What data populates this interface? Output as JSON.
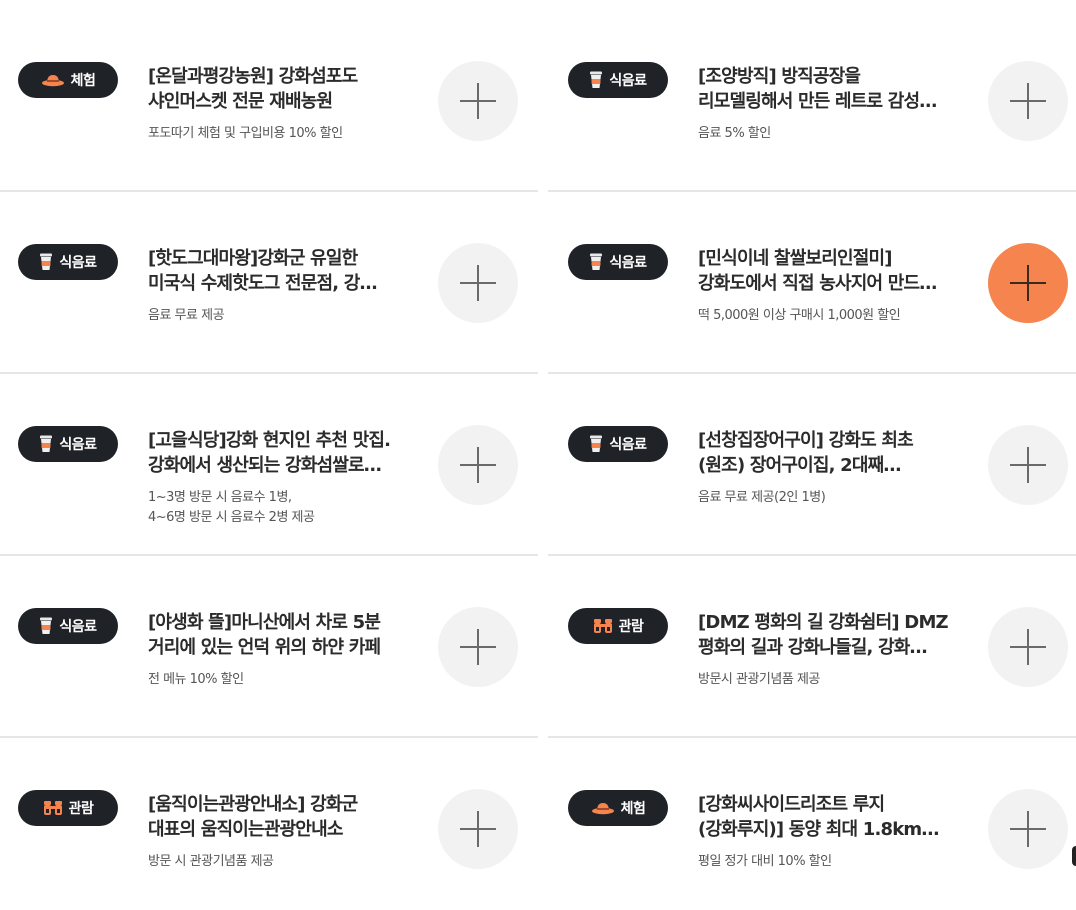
{
  "categories": {
    "experience": "체험",
    "food": "식음료",
    "tour": "관람"
  },
  "cards": [
    {
      "category": "체험",
      "icon": "hat-icon",
      "title": "[온달과평강농원] 강화섬포도 샤인머스켓 전문 재배농원",
      "benefit": "포도따기 체험 및 구입비용 10% 할인",
      "selected": false
    },
    {
      "category": "식음료",
      "icon": "coffee-cup-icon",
      "title": "[조양방직] 방직공장을 리모델링해서 만든 레트로 감성…",
      "benefit": "음료 5% 할인",
      "selected": false
    },
    {
      "category": "식음료",
      "icon": "coffee-cup-icon",
      "title": "[핫도그대마왕]강화군 유일한 미국식 수제핫도그 전문점, 강…",
      "benefit": "음료 무료 제공",
      "selected": false
    },
    {
      "category": "식음료",
      "icon": "coffee-cup-icon",
      "title": "[민식이네 찰쌀보리인절미] 강화도에서 직접 농사지어 만드…",
      "benefit": "떡 5,000원 이상 구매시 1,000원 할인",
      "selected": true
    },
    {
      "category": "식음료",
      "icon": "coffee-cup-icon",
      "title": "[고을식당]강화 현지인 추천 맛집. 강화에서 생산되는 강화섬쌀로…",
      "benefit": "1~3명 방문 시 음료수 1병,\n4~6명 방문 시 음료수 2병 제공",
      "selected": false
    },
    {
      "category": "식음료",
      "icon": "coffee-cup-icon",
      "title": "[선창집장어구이] 강화도 최초 (원조) 장어구이집, 2대째…",
      "benefit": "음료 무료 제공(2인 1병)",
      "selected": false
    },
    {
      "category": "식음료",
      "icon": "coffee-cup-icon",
      "title": "[야생화 뜰]마니산에서 차로 5분 거리에 있는 언덕 위의 하얀 카페",
      "benefit": "전 메뉴 10% 할인",
      "selected": false
    },
    {
      "category": "관람",
      "icon": "binoculars-icon",
      "title": "[DMZ 평화의 길 강화쉼터] DMZ 평화의 길과 강화나들길, 강화…",
      "benefit": "방문시 관광기념품 제공",
      "selected": false
    },
    {
      "category": "관람",
      "icon": "binoculars-icon",
      "title": "[움직이는관광안내소] 강화군 대표의 움직이는관광안내소",
      "benefit": "방문 시 관광기념품 제공",
      "selected": false
    },
    {
      "category": "체험",
      "icon": "hat-icon",
      "title": "[강화씨사이드리조트 루지 (강화루지)] 동양 최대 1.8km…",
      "benefit": "평일 정가 대비 10% 할인",
      "selected": false
    }
  ],
  "colors": {
    "badge_bg": "#1f2328",
    "add_button": "#f2f2f2",
    "add_button_active": "#f6844f",
    "accent": "#f6844f"
  }
}
